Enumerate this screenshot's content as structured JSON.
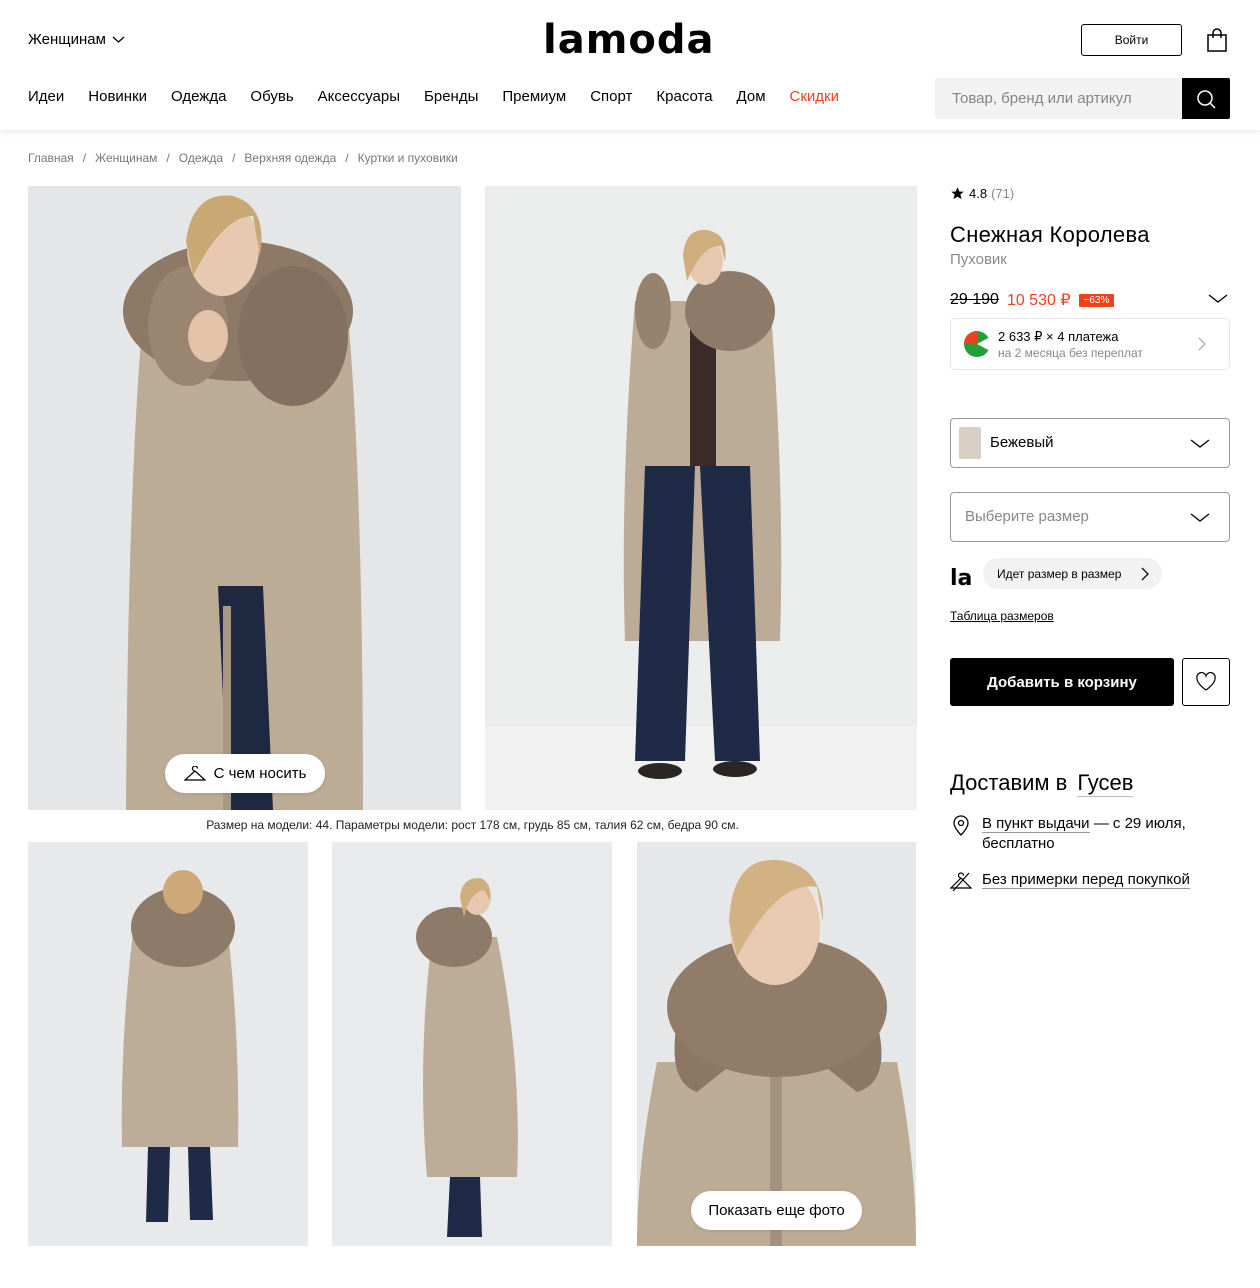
{
  "header": {
    "gender_label": "Женщинам",
    "logo": "lamoda",
    "login_label": "Войти",
    "nav": [
      "Идеи",
      "Новинки",
      "Одежда",
      "Обувь",
      "Аксессуары",
      "Бренды",
      "Премиум",
      "Спорт",
      "Красота",
      "Дом",
      "Скидки"
    ],
    "search_placeholder": "Товар, бренд или артикул"
  },
  "breadcrumbs": [
    "Главная",
    "/",
    "Женщинам",
    "/",
    "Одежда",
    "/",
    "Верхняя одежда",
    "/",
    "Куртки и пуховики"
  ],
  "gallery": {
    "wear_button": "С чем носить",
    "model_caption": "Размер на модели: 44. Параметры модели: рост 178 см, грудь 85 см, талия 62 см, бедра 90 см.",
    "more_photos": "Показать еще фото"
  },
  "product": {
    "rating": "4.8",
    "reviews": "(71)",
    "brand": "Снежная Королева",
    "type": "Пуховик",
    "old_price": "29 190",
    "new_price": "10 530 ₽",
    "discount": "−63%",
    "split_line1": "2 633 ₽ × 4 платежа",
    "split_line2": "на 2 месяца без переплат",
    "color": "Бежевый",
    "size_placeholder": "Выберите размер",
    "la_logo": "la",
    "fit_text": "Идет размер в размер",
    "size_table": "Таблица размеров",
    "add_to_cart": "Добавить в корзину"
  },
  "delivery": {
    "title": "Доставим в",
    "city": "Гусев",
    "pickup_link": "В пункт выдачи",
    "pickup_rest": " — с 29 июля,",
    "pickup_free": "бесплатно",
    "no_fitting": "Без примерки перед покупкой"
  },
  "colors": {
    "accent": "#f0401e",
    "coat": "#bfae98",
    "fur": "#8f7a66",
    "jeans": "#1f2a44"
  }
}
